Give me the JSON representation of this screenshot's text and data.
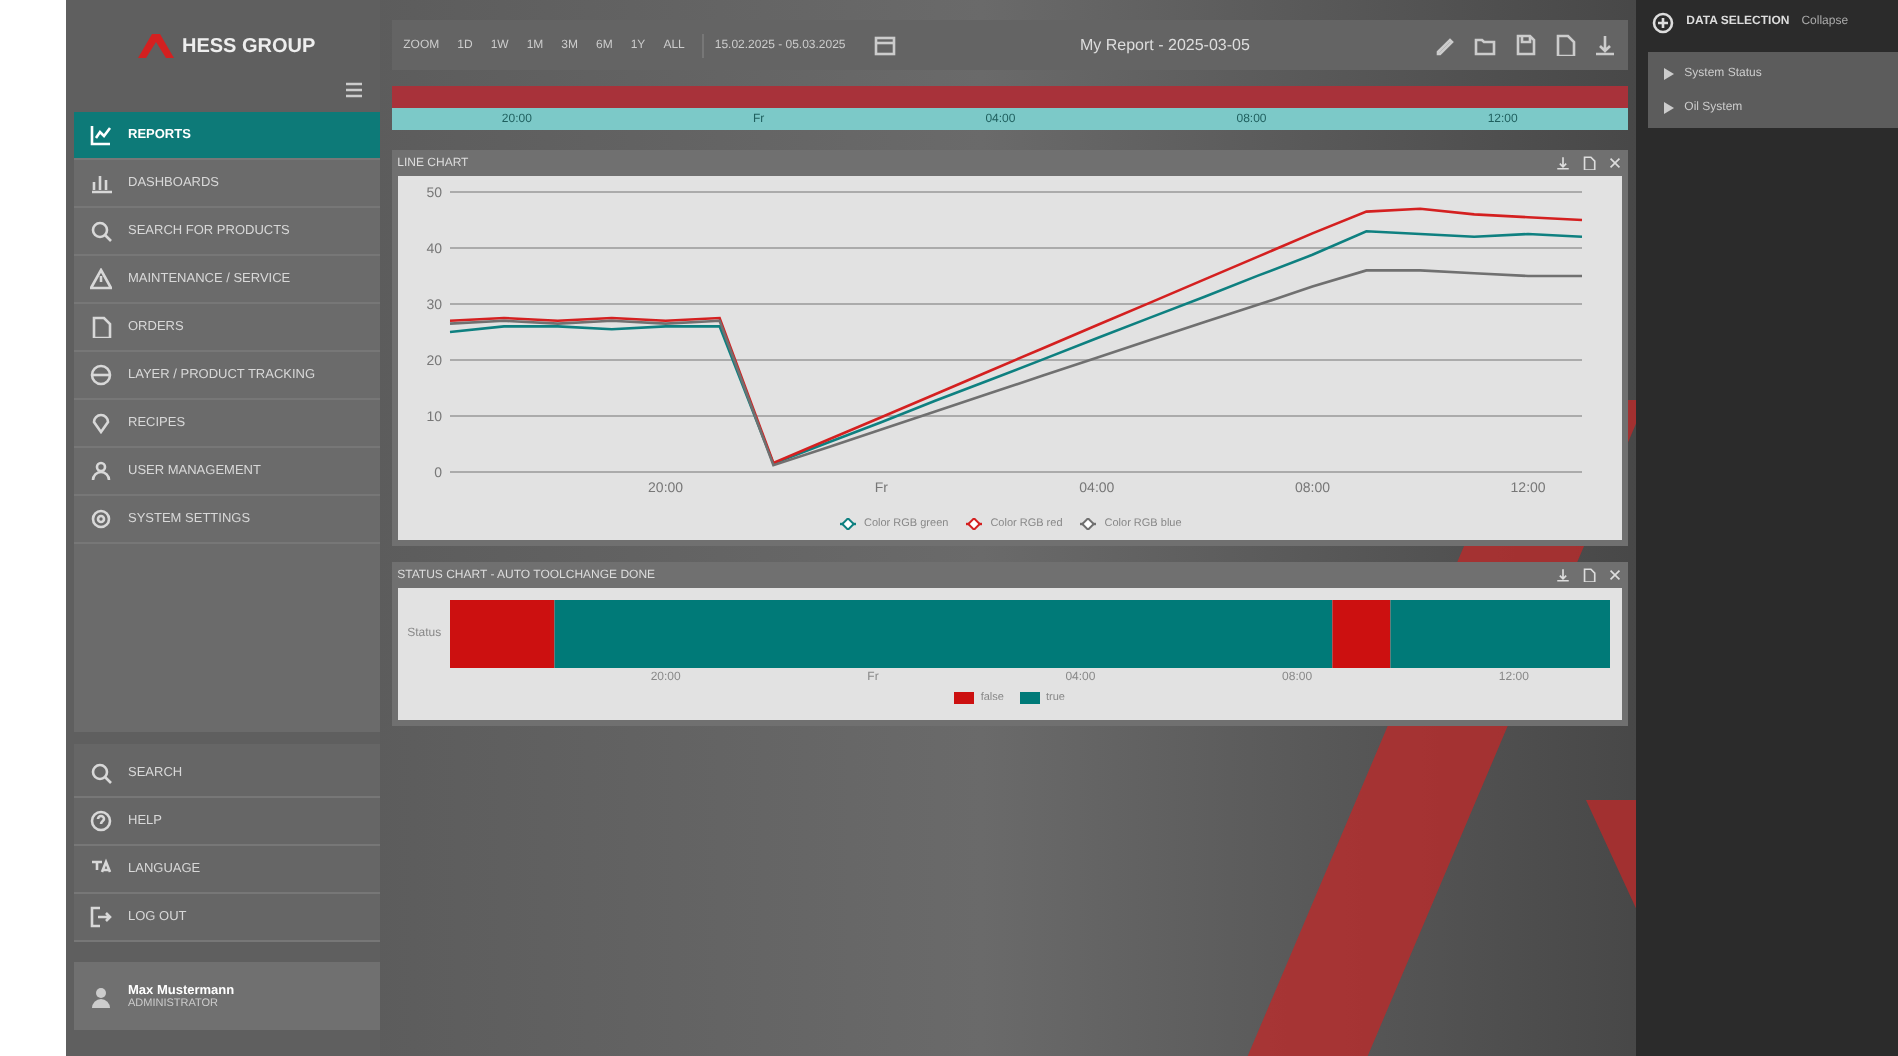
{
  "sidebar": {
    "logo": "HESS GROUP",
    "items": [
      {
        "label": "REPORTS",
        "selected": true
      },
      {
        "label": "DASHBOARDS",
        "selected": false
      },
      {
        "label": "SEARCH FOR PRODUCTS",
        "selected": false
      },
      {
        "label": "MAINTENANCE / SERVICE",
        "selected": false
      },
      {
        "label": "ORDERS",
        "selected": false
      },
      {
        "label": "LAYER / PRODUCT TRACKING",
        "selected": false
      },
      {
        "label": "RECIPES",
        "selected": false
      },
      {
        "label": "USER MANAGEMENT",
        "selected": false
      },
      {
        "label": "SYSTEM SETTINGS",
        "selected": false
      }
    ],
    "bottom_items": [
      "SEARCH",
      "HELP",
      "LANGUAGE",
      "LOG OUT"
    ],
    "user": {
      "name": "Max Mustermann",
      "role": "ADMINISTRATOR"
    }
  },
  "toolbar": {
    "zoom_label": "ZOOM",
    "ranges": [
      "1D",
      "1W",
      "1M",
      "3M",
      "6M",
      "1Y",
      "ALL"
    ],
    "date_range": "15.02.2025 - 05.03.2025",
    "title": "My Report - 2025-03-05"
  },
  "navigator": {
    "ticks": [
      "20:00",
      "Fr",
      "04:00",
      "08:00",
      "12:00"
    ]
  },
  "line_chart": {
    "title": "LINE CHART",
    "chart_data": {
      "type": "line",
      "categories": [
        null,
        null,
        null,
        null,
        "20:00",
        null,
        null,
        null,
        "Fr",
        null,
        null,
        null,
        "04:00",
        null,
        null,
        null,
        "08:00",
        null,
        null,
        null,
        "12:00",
        null
      ],
      "yticks": [
        0,
        10,
        20,
        30,
        40,
        50
      ],
      "ylim": [
        0,
        50
      ],
      "grid": true,
      "series": [
        {
          "name": "Color RGB green",
          "color": "#0e8080",
          "values": [
            25,
            26,
            26,
            25.5,
            26,
            26,
            1.5,
            5.2,
            8.9,
            12.7,
            16.4,
            20.1,
            23.9,
            27.6,
            31.3,
            35.1,
            38.8,
            43,
            42.5,
            42,
            42.5,
            42
          ]
        },
        {
          "name": "Color RGB red",
          "color": "#d42020",
          "values": [
            27,
            27.5,
            27,
            27.5,
            27,
            27.5,
            1.6,
            5.7,
            9.8,
            13.9,
            18.0,
            22.1,
            26.2,
            30.3,
            34.4,
            38.5,
            42.6,
            46.5,
            47,
            46,
            45.5,
            45
          ]
        },
        {
          "name": "Color RGB blue",
          "color": "#707070",
          "values": [
            26.5,
            27,
            26.5,
            27,
            26.5,
            27,
            1.2,
            4.4,
            7.6,
            10.8,
            14,
            17.2,
            20.4,
            23.6,
            26.8,
            29.9,
            33.1,
            36,
            36,
            35.5,
            35,
            35
          ]
        }
      ]
    }
  },
  "status_chart": {
    "title": "STATUS CHART - AUTO TOOLCHANGE DONE",
    "row_label": "Status",
    "axis_labels": [
      "20:00",
      "Fr",
      "04:00",
      "08:00",
      "12:00"
    ],
    "legend": [
      {
        "name": "false",
        "color": "#cc1010"
      },
      {
        "name": "true",
        "color": "#007a78"
      }
    ]
  },
  "data_selection": {
    "title": "DATA SELECTION",
    "action": "Collapse",
    "items": [
      "System Status",
      "Oil System"
    ]
  }
}
